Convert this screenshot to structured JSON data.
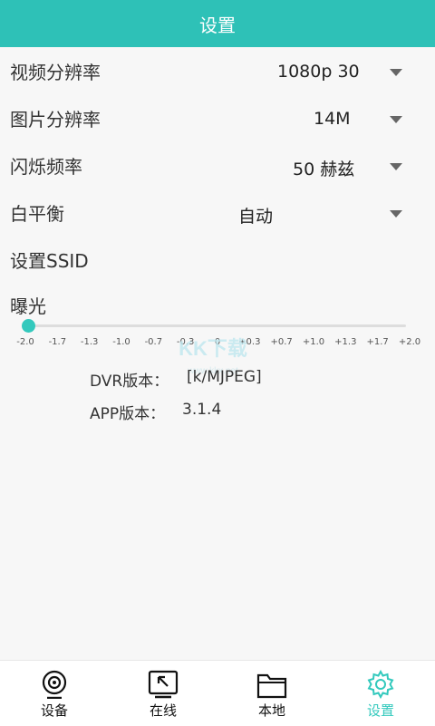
{
  "header": {
    "title": "设置"
  },
  "settings": [
    {
      "label": "视频分辨率",
      "value": "1080p 30"
    },
    {
      "label": "图片分辨率",
      "value": "14M"
    },
    {
      "label": "闪烁频率",
      "value": "50 赫兹"
    },
    {
      "label": "白平衡",
      "value": "自动"
    },
    {
      "label": "设置SSID"
    }
  ],
  "exposure": {
    "label": "曝光",
    "ticks": [
      "-2.0",
      "-1.7",
      "-1.3",
      "-1.0",
      "-0.7",
      "-0.3",
      "0",
      "+0.3",
      "+0.7",
      "+1.0",
      "+1.3",
      "+1.7",
      "+2.0"
    ],
    "selected_index": 0
  },
  "info": {
    "dvr_label": "DVR版本：",
    "dvr_value": "[k/MJPEG]",
    "app_label": "APP版本：",
    "app_value": "3.1.4"
  },
  "watermark": {
    "text": "KK下载",
    "url": "www.kkx.net"
  },
  "nav": [
    {
      "label": "设备",
      "icon": "camera-icon"
    },
    {
      "label": "在线",
      "icon": "arrow-box-icon"
    },
    {
      "label": "本地",
      "icon": "folder-icon"
    },
    {
      "label": "设置",
      "icon": "gear-icon"
    }
  ],
  "colors": {
    "accent": "#2ec1b7",
    "slider": "#33c9bd"
  }
}
